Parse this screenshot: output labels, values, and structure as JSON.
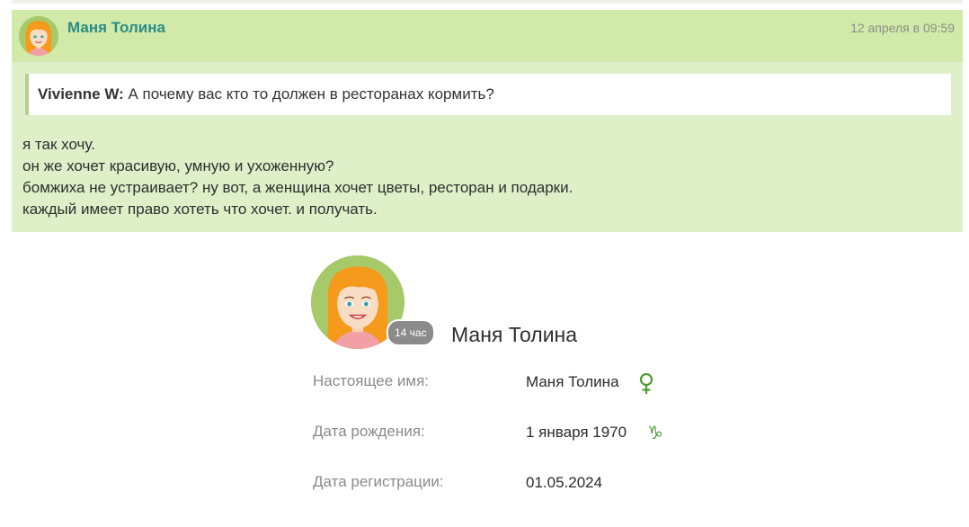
{
  "post": {
    "author": "Маня Толина",
    "date": "12 апреля в 09:59",
    "quote": {
      "author": "Vivienne W:",
      "text": "А почему вас кто то должен в ресторанах кормить?"
    },
    "lines": [
      "я так хочу.",
      "он же хочет красивую, умную и ухоженную?",
      "бомжиха не устраивает? ну вот, а женщина хочет цветы, ресторан и подарки.",
      "каждый имеет право хотеть что хочет. и получать."
    ]
  },
  "profile": {
    "name": "Маня Толина",
    "online_badge": "14 час",
    "rows": [
      {
        "label": "Настоящее имя:",
        "value": "Маня Толина",
        "icon": "female-sign-icon"
      },
      {
        "label": "Дата рождения:",
        "value": "1 января 1970",
        "icon": "capricorn-icon"
      },
      {
        "label": "Дата регистрации:",
        "value": "01.05.2024"
      }
    ]
  },
  "colors": {
    "header_bg": "#d2eaa9",
    "post_bg": "#dff0c8",
    "author_link": "#2a8c85",
    "icon_green": "#4f9a32"
  }
}
